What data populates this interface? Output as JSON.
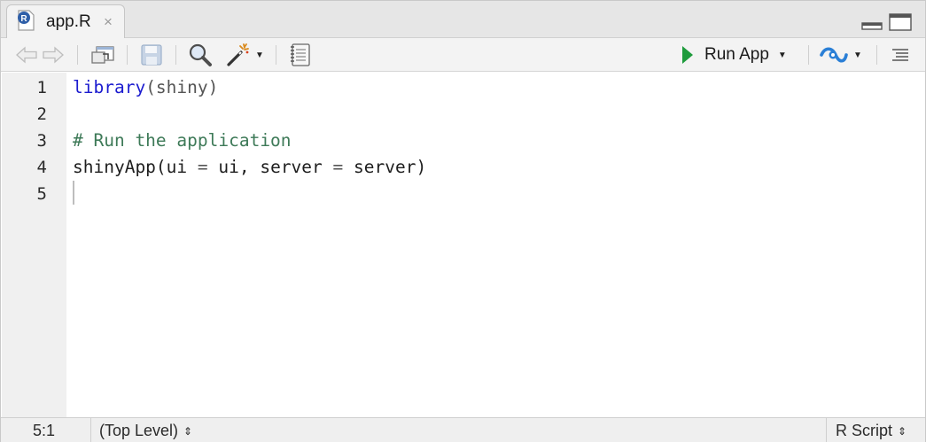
{
  "tab": {
    "title": "app.R",
    "close_glyph": "×",
    "icon": "r-file-icon"
  },
  "toolbar": {
    "run_app_label": "Run App",
    "icons": [
      "back-arrow-icon",
      "forward-arrow-icon",
      "show-in-window-icon",
      "save-icon",
      "find-icon",
      "magic-wand-icon",
      "compile-report-icon",
      "publish-icon",
      "outline-icon"
    ]
  },
  "editor": {
    "line_numbers": [
      "1",
      "2",
      "3",
      "4",
      "5"
    ],
    "lines": [
      {
        "kw": "library",
        "rest": "(shiny)"
      },
      {
        "text": ""
      },
      {
        "comment": "# Run the application"
      },
      {
        "a": "shinyApp(ui ",
        "eq1": "=",
        "b": " ui, server ",
        "eq2": "=",
        "c": " server)"
      },
      {
        "text": ""
      }
    ]
  },
  "status": {
    "cursor_position": "5:1",
    "scope": "(Top Level)",
    "file_type": "R Script",
    "updown_glyph": "⇕"
  },
  "colors": {
    "keyword": "#1b1bcf",
    "comment": "#3e7a58",
    "run_green": "#1e9b3c",
    "publish_blue": "#2a7fd6"
  }
}
